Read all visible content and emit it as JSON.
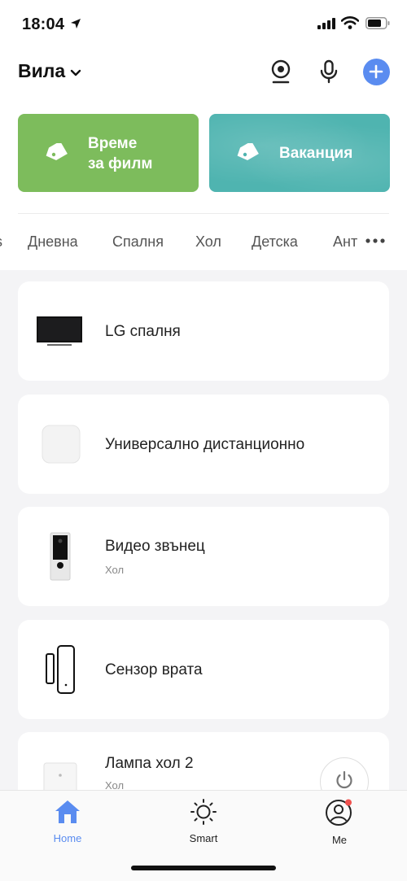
{
  "status_bar": {
    "time": "18:04"
  },
  "header": {
    "home_name": "Вила"
  },
  "scenes": [
    {
      "label_line1": "Време",
      "label_line2": "за филм",
      "color": "#7dbc5c"
    },
    {
      "label": "Ваканция",
      "color": "#4fb4b0"
    }
  ],
  "rooms": {
    "tabs": [
      "s",
      "Дневна",
      "Спалня",
      "Хол",
      "Детска",
      "Ант"
    ]
  },
  "devices": [
    {
      "name": "LG спалня",
      "room": ""
    },
    {
      "name": "Универсално дистанционно",
      "room": ""
    },
    {
      "name": "Видео звънец",
      "room": "Хол"
    },
    {
      "name": "Сензор врата",
      "room": ""
    },
    {
      "name": "Лампа хол 2",
      "room": "Хол"
    }
  ],
  "tabbar": {
    "home": "Home",
    "smart": "Smart",
    "me": "Me",
    "active_color": "#5a8cf0"
  }
}
